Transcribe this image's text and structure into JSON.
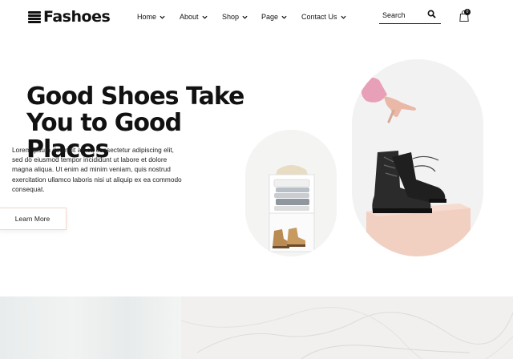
{
  "brand": {
    "name": "Fashoes"
  },
  "nav": {
    "items": [
      {
        "label": "Home"
      },
      {
        "label": "About"
      },
      {
        "label": "Shop"
      },
      {
        "label": "Page"
      },
      {
        "label": "Contact Us"
      }
    ]
  },
  "search": {
    "placeholder": "Search",
    "icon": "search-icon"
  },
  "cart": {
    "count": "0",
    "icon": "shopping-bag-icon"
  },
  "hero": {
    "title_line1": "Good Shoes Take",
    "title_line2": "You to Good Places",
    "body": "Lorem ipsum dolor sit amet, consectetur adipiscing elit, sed do eiusmod tempor incididunt ut labore et dolore magna aliqua. Ut enim ad minim veniam, quis nostrud exercitation ullamco laboris nisi ut aliquip ex ea commodo consequat.",
    "button_label": "Learn More"
  },
  "colors": {
    "text": "#111111",
    "button_border": "#f3d9c9",
    "pedestal": "#f1d0c2",
    "sleeve": "#e8a0b8",
    "boot": "#2b2b2b",
    "tan_boot": "#b98a52"
  }
}
